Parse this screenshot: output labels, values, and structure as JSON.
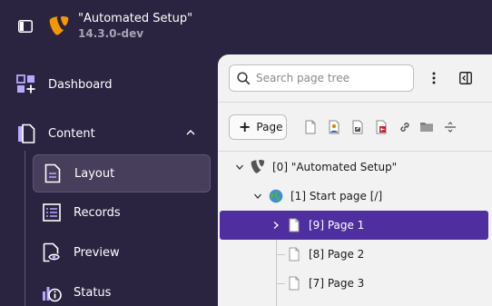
{
  "header": {
    "site_name": "\"Automated Setup\"",
    "version": "14.3.0-dev"
  },
  "sidebar": {
    "modules": [
      {
        "label": "Dashboard",
        "icon": "dashboard-icon"
      },
      {
        "label": "Content",
        "icon": "content-icon",
        "expanded": true
      }
    ],
    "content_submodules": [
      {
        "label": "Layout",
        "icon": "layout-icon",
        "active": true
      },
      {
        "label": "Records",
        "icon": "records-icon"
      },
      {
        "label": "Preview",
        "icon": "preview-icon"
      },
      {
        "label": "Status",
        "icon": "status-icon"
      }
    ]
  },
  "page_tree": {
    "search_placeholder": "Search page tree",
    "new_page_label": "Page",
    "nodes": [
      {
        "label": "[0] \"Automated Setup\"",
        "icon": "typo3-root-icon",
        "expanded": true
      },
      {
        "label": "[1] Start page [/]",
        "icon": "globe-page-icon",
        "expanded": true
      },
      {
        "label": "[9] Page 1",
        "icon": "page-icon",
        "selected": true,
        "has_children": true
      },
      {
        "label": "[8] Page 2",
        "icon": "page-icon"
      },
      {
        "label": "[7] Page 3",
        "icon": "page-icon"
      }
    ]
  },
  "colors": {
    "sidebar_bg": "#2b2440",
    "selected_node_bg": "#4f2ea0",
    "typo3_orange": "#f49700"
  }
}
